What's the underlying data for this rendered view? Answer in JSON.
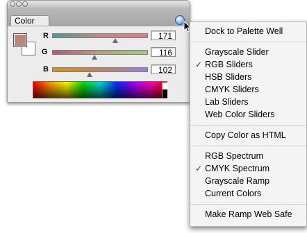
{
  "palette": {
    "tab_label": "Color",
    "swatch_fg_color": "#b98678",
    "channels": [
      {
        "label": "R",
        "value": "171",
        "fraction": 0.67
      },
      {
        "label": "G",
        "value": "116",
        "fraction": 0.45
      },
      {
        "label": "B",
        "value": "102",
        "fraction": 0.4
      }
    ]
  },
  "menu": {
    "items": [
      {
        "label": "Dock to Palette Well",
        "checked": false
      },
      {
        "label": "Grayscale Slider",
        "checked": false
      },
      {
        "label": "RGB Sliders",
        "checked": true
      },
      {
        "label": "HSB Sliders",
        "checked": false
      },
      {
        "label": "CMYK Sliders",
        "checked": false
      },
      {
        "label": "Lab Sliders",
        "checked": false
      },
      {
        "label": "Web Color Sliders",
        "checked": false
      },
      {
        "label": "Copy Color as HTML",
        "checked": false
      },
      {
        "label": "RGB Spectrum",
        "checked": false
      },
      {
        "label": "CMYK Spectrum",
        "checked": true
      },
      {
        "label": "Grayscale Ramp",
        "checked": false
      },
      {
        "label": "Current Colors",
        "checked": false
      },
      {
        "label": "Make Ramp Web Safe",
        "checked": false
      }
    ],
    "check_glyph": "✓"
  }
}
